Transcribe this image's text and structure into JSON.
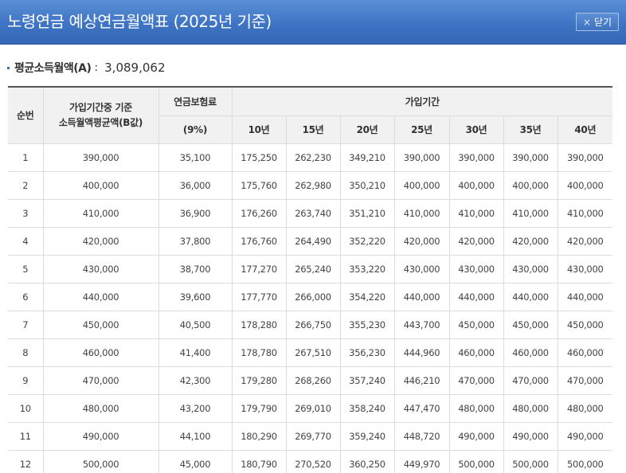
{
  "window": {
    "title": "노령연금 예상연금월액표 (2025년 기준)",
    "close_label": "닫기",
    "close_icon": "×"
  },
  "summary": {
    "label": "평균소득월액(A)",
    "separator": ":",
    "value": "3,089,062"
  },
  "table": {
    "headers": {
      "seq": "순번",
      "income_line1": "가입기간중 기준",
      "income_line2": "소득월액평균액(B값)",
      "premium": "연금보험료",
      "premium_rate": "(9%)",
      "period": "가입기간",
      "years": [
        "10년",
        "15년",
        "20년",
        "25년",
        "30년",
        "35년",
        "40년"
      ]
    },
    "rows": [
      [
        "1",
        "390,000",
        "35,100",
        "175,250",
        "262,230",
        "349,210",
        "390,000",
        "390,000",
        "390,000",
        "390,000"
      ],
      [
        "2",
        "400,000",
        "36,000",
        "175,760",
        "262,980",
        "350,210",
        "400,000",
        "400,000",
        "400,000",
        "400,000"
      ],
      [
        "3",
        "410,000",
        "36,900",
        "176,260",
        "263,740",
        "351,210",
        "410,000",
        "410,000",
        "410,000",
        "410,000"
      ],
      [
        "4",
        "420,000",
        "37,800",
        "176,760",
        "264,490",
        "352,220",
        "420,000",
        "420,000",
        "420,000",
        "420,000"
      ],
      [
        "5",
        "430,000",
        "38,700",
        "177,270",
        "265,240",
        "353,220",
        "430,000",
        "430,000",
        "430,000",
        "430,000"
      ],
      [
        "6",
        "440,000",
        "39,600",
        "177,770",
        "266,000",
        "354,220",
        "440,000",
        "440,000",
        "440,000",
        "440,000"
      ],
      [
        "7",
        "450,000",
        "40,500",
        "178,280",
        "266,750",
        "355,230",
        "443,700",
        "450,000",
        "450,000",
        "450,000"
      ],
      [
        "8",
        "460,000",
        "41,400",
        "178,780",
        "267,510",
        "356,230",
        "444,960",
        "460,000",
        "460,000",
        "460,000"
      ],
      [
        "9",
        "470,000",
        "42,300",
        "179,280",
        "268,260",
        "357,240",
        "446,210",
        "470,000",
        "470,000",
        "470,000"
      ],
      [
        "10",
        "480,000",
        "43,200",
        "179,790",
        "269,010",
        "358,240",
        "447,470",
        "480,000",
        "480,000",
        "480,000"
      ],
      [
        "11",
        "490,000",
        "44,100",
        "180,290",
        "269,770",
        "359,240",
        "448,720",
        "490,000",
        "490,000",
        "490,000"
      ],
      [
        "12",
        "500,000",
        "45,000",
        "180,790",
        "270,520",
        "360,250",
        "449,970",
        "500,000",
        "500,000",
        "500,000"
      ]
    ]
  },
  "colors": {
    "titlebar": "#3e74c4",
    "header_bg": "#f1f1f1",
    "border": "#dcdcdc",
    "bullet": "#3d6fc0"
  }
}
